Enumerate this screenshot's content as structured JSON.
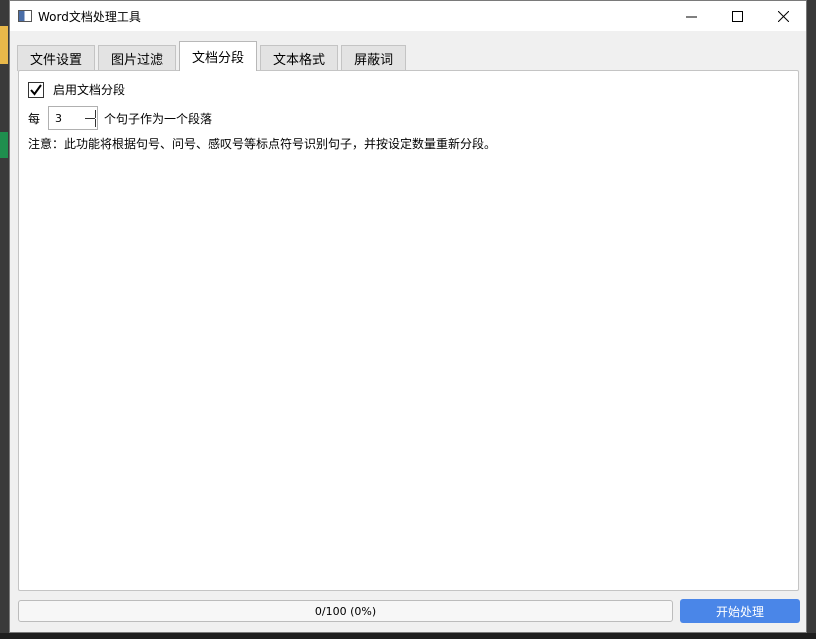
{
  "window": {
    "title": "Word文档处理工具",
    "controls": {
      "minimize": "minimize-icon",
      "maximize": "maximize-icon",
      "close": "close-icon"
    }
  },
  "tabs": [
    {
      "label": "文件设置",
      "active": false
    },
    {
      "label": "图片过滤",
      "active": false
    },
    {
      "label": "文档分段",
      "active": true
    },
    {
      "label": "文本格式",
      "active": false
    },
    {
      "label": "屏蔽词",
      "active": false
    }
  ],
  "segmentation": {
    "enable_label": "启用文档分段",
    "enabled": true,
    "prefix_label": "每",
    "sentences_per_paragraph": "3",
    "suffix_label": "个句子作为一个段落",
    "note": "注意：此功能将根据句号、问号、感叹号等标点符号识别句子，并按设定数量重新分段。"
  },
  "footer": {
    "progress_text": "0/100 (0%)",
    "progress_value": 0,
    "start_button": "开始处理"
  },
  "colors": {
    "accent": "#4a86e8",
    "window_bg": "#f0f0f0",
    "panel_bg": "#ffffff"
  }
}
